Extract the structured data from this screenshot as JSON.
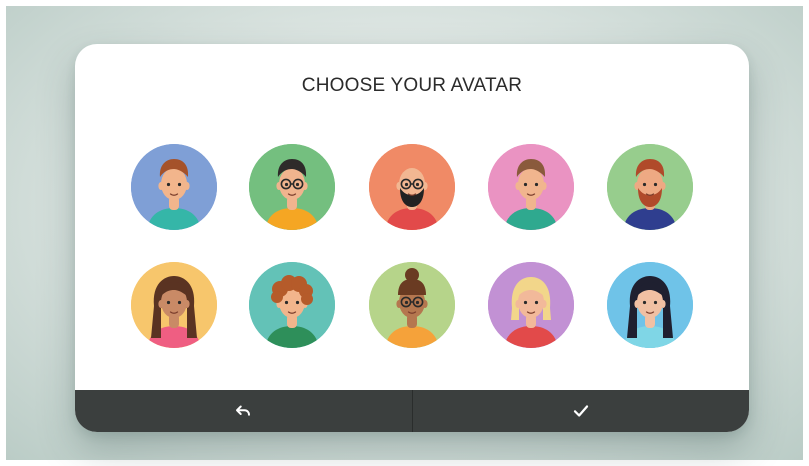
{
  "dialog": {
    "title": "CHOOSE YOUR AVATAR"
  },
  "avatars": [
    {
      "id": "avatar-1",
      "bg": "#7f9fd6",
      "skin": "#f2b58c",
      "hair": "#a5522a",
      "shirt": "#35b6a8",
      "hair_style": "short",
      "beard": false,
      "glasses": false
    },
    {
      "id": "avatar-2",
      "bg": "#74bf7f",
      "skin": "#f0b48e",
      "hair": "#2e2b2a",
      "shirt": "#f5a623",
      "hair_style": "short",
      "beard": false,
      "glasses": true
    },
    {
      "id": "avatar-3",
      "bg": "#f08a66",
      "skin": "#f2b792",
      "hair": "#2e2b2a",
      "shirt": "#e24a4a",
      "hair_style": "bald",
      "beard": true,
      "glasses": true
    },
    {
      "id": "avatar-4",
      "bg": "#ea93c2",
      "skin": "#f1b58e",
      "hair": "#8a5a3c",
      "shirt": "#2fa98f",
      "hair_style": "short",
      "beard": false,
      "glasses": false
    },
    {
      "id": "avatar-5",
      "bg": "#97cd8d",
      "skin": "#eea983",
      "hair": "#b04a2a",
      "shirt": "#2f3e8f",
      "hair_style": "short",
      "beard": true,
      "glasses": false
    },
    {
      "id": "avatar-6",
      "bg": "#f7c66c",
      "skin": "#c98a66",
      "hair": "#5a3322",
      "shirt": "#ef5e82",
      "hair_style": "long",
      "beard": false,
      "glasses": false
    },
    {
      "id": "avatar-7",
      "bg": "#63c2b7",
      "skin": "#f2b58c",
      "hair": "#b55b2a",
      "shirt": "#2e8f5a",
      "hair_style": "curly",
      "beard": false,
      "glasses": false
    },
    {
      "id": "avatar-8",
      "bg": "#b6d48a",
      "skin": "#b5774f",
      "hair": "#6a3b22",
      "shirt": "#f5a23a",
      "hair_style": "bun",
      "beard": false,
      "glasses": true
    },
    {
      "id": "avatar-9",
      "bg": "#c291d4",
      "skin": "#f2b99a",
      "hair": "#f2d68a",
      "shirt": "#e24a4a",
      "hair_style": "bob",
      "beard": false,
      "glasses": false
    },
    {
      "id": "avatar-10",
      "bg": "#6fc3e8",
      "skin": "#f1c0a3",
      "hair": "#1f2030",
      "shirt": "#7fd6e6",
      "hair_style": "long",
      "beard": false,
      "glasses": false
    }
  ],
  "footer": {
    "back_icon": "undo-arrow-icon",
    "confirm_icon": "checkmark-icon"
  },
  "colors": {
    "card": "#ffffff",
    "footer": "#3b3f3e",
    "title": "#2b2b2b"
  }
}
